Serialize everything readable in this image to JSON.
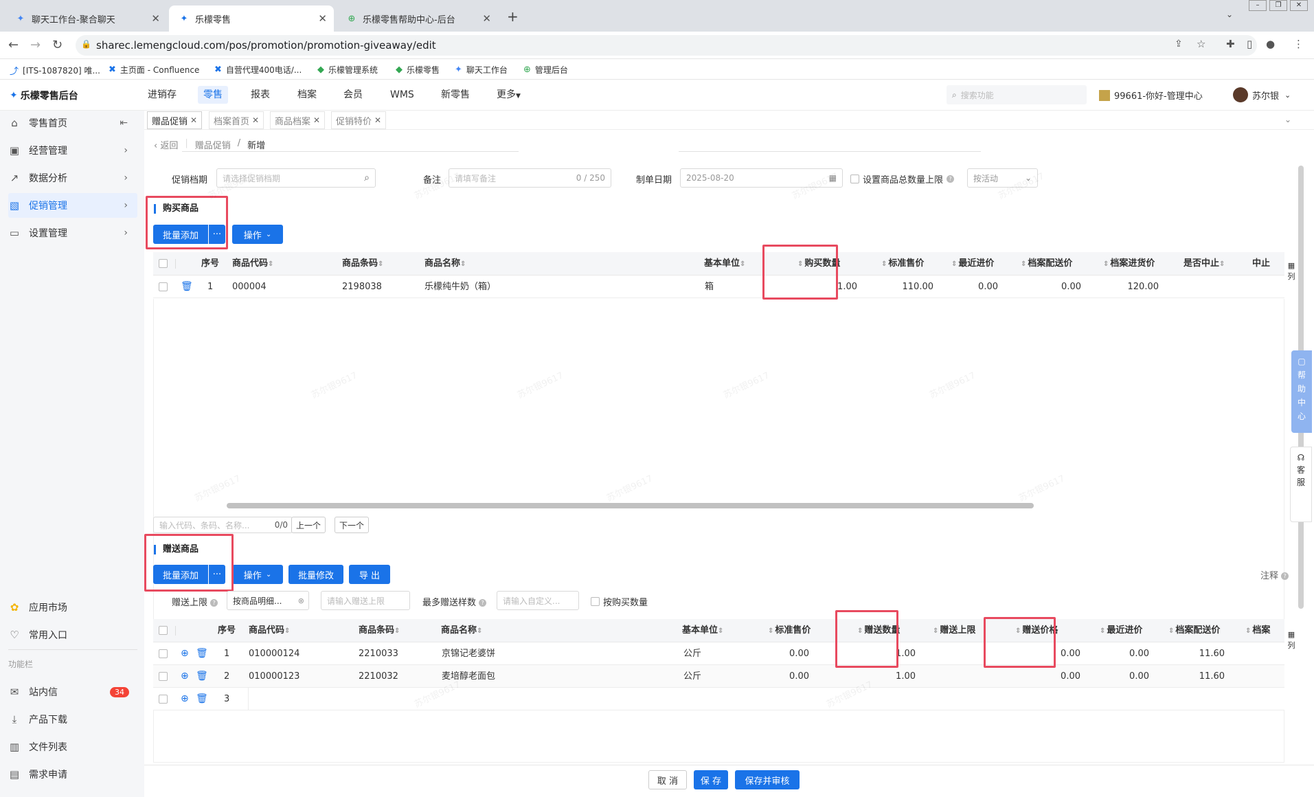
{
  "browser": {
    "tabs": [
      {
        "title": "聊天工作台-聚合聊天"
      },
      {
        "title": "乐檬零售"
      },
      {
        "title": "乐檬零售帮助中心-后台"
      }
    ],
    "url": "sharec.lemengcloud.com/pos/promotion/promotion-giveaway/edit",
    "bookmarks": [
      {
        "label": "[ITS-1087820] 唯..."
      },
      {
        "label": "主页面 - Confluence"
      },
      {
        "label": "自营代理400电话/..."
      },
      {
        "label": "乐檬管理系统"
      },
      {
        "label": "乐檬零售"
      },
      {
        "label": "聊天工作台"
      },
      {
        "label": "管理后台"
      }
    ]
  },
  "header": {
    "logo": "乐檬零售后台",
    "nav": [
      "进销存",
      "零售",
      "报表",
      "档案",
      "会员",
      "WMS",
      "新零售",
      "更多"
    ],
    "search_placeholder": "搜索功能",
    "store": "99661-你好-管理中心",
    "user": "苏尔银"
  },
  "sidebar": {
    "items": [
      {
        "label": "零售首页",
        "icon": "home-icon"
      },
      {
        "label": "经营管理",
        "icon": "dashboard-icon"
      },
      {
        "label": "数据分析",
        "icon": "chart-icon"
      },
      {
        "label": "促销管理",
        "icon": "promotion-icon"
      },
      {
        "label": "设置管理",
        "icon": "folder-icon"
      }
    ],
    "bottom": [
      {
        "label": "应用市场",
        "icon": "apps-icon"
      },
      {
        "label": "常用入口",
        "icon": "heart-icon"
      }
    ],
    "section_label": "功能栏",
    "func": [
      {
        "label": "站内信",
        "icon": "mail-icon",
        "badge": "34"
      },
      {
        "label": "产品下载",
        "icon": "download-icon"
      },
      {
        "label": "文件列表",
        "icon": "file-icon"
      },
      {
        "label": "需求申请",
        "icon": "request-icon"
      }
    ]
  },
  "page_tabs": [
    {
      "label": "赠品促销"
    },
    {
      "label": "档案首页"
    },
    {
      "label": "商品档案"
    },
    {
      "label": "促销特价"
    }
  ],
  "breadcrumb": {
    "back": "返回",
    "parent": "赠品促销",
    "current": "新增"
  },
  "form": {
    "promo_file_label": "促销档期",
    "promo_file_placeholder": "请选择促销档期",
    "remark_label": "备注",
    "remark_placeholder": "请填写备注",
    "remark_count": "0 / 250",
    "date_label": "制单日期",
    "date_value": "2025-08-20",
    "limit_label": "设置商品总数量上限",
    "limit_select": "按活动"
  },
  "buy_section": {
    "title": "购买商品",
    "batch_add": "批量添加",
    "more": "···",
    "operate": "操作",
    "columns": [
      "序号",
      "商品代码",
      "商品条码",
      "商品名称",
      "基本单位",
      "购买数量",
      "标准售价",
      "最近进价",
      "档案配送价",
      "档案进货价",
      "是否中止",
      "中止"
    ],
    "rows": [
      {
        "no": "1",
        "code": "000004",
        "barcode": "2198038",
        "name": "乐檬纯牛奶（箱）",
        "unit": "箱",
        "qty": "1.00",
        "price": "110.00",
        "last": "0.00",
        "dist": "0.00",
        "purchase": "120.00"
      }
    ],
    "col_setting": "列",
    "search_placeholder": "输入代码、条码、名称...",
    "search_count": "0/0",
    "prev": "上一个",
    "next": "下一个"
  },
  "gift_section": {
    "title": "赠送商品",
    "batch_add": "批量添加",
    "more": "···",
    "operate": "操作",
    "batch_edit": "批量修改",
    "export": "导 出",
    "note": "注释",
    "limit_label": "赠送上限",
    "limit_value": "按商品明细...",
    "limit_input_placeholder": "请输入赠送上限",
    "max_kinds_label": "最多赠送样数",
    "max_kinds_placeholder": "请输入自定义...",
    "by_buy_qty": "按购买数量",
    "columns": [
      "序号",
      "商品代码",
      "商品条码",
      "商品名称",
      "基本单位",
      "标准售价",
      "赠送数量",
      "赠送上限",
      "赠送价格",
      "最近进价",
      "档案配送价",
      "档案"
    ],
    "rows": [
      {
        "no": "1",
        "code": "010000124",
        "barcode": "2210033",
        "name": "京锦记老婆饼",
        "unit": "公斤",
        "price": "0.00",
        "qty": "1.00",
        "limit": "",
        "gprice": "0.00",
        "last": "0.00",
        "dist": "11.60"
      },
      {
        "no": "2",
        "code": "010000123",
        "barcode": "2210032",
        "name": "麦培醇老面包",
        "unit": "公斤",
        "price": "0.00",
        "qty": "1.00",
        "limit": "",
        "gprice": "0.00",
        "last": "0.00",
        "dist": "11.60"
      },
      {
        "no": "3",
        "code": "",
        "barcode": "",
        "name": "",
        "unit": "",
        "price": "",
        "qty": "",
        "limit": "",
        "gprice": "",
        "last": "",
        "dist": ""
      }
    ],
    "col_setting": "列"
  },
  "footer": {
    "cancel": "取 消",
    "save": "保 存",
    "save_audit": "保存并审核"
  },
  "side_help": {
    "help": "帮助中心",
    "service": "客服"
  },
  "watermark": "苏尔银9617",
  "colors": {
    "accent": "#1a73e8",
    "highlight": "#e84a5f",
    "badge": "#f44336"
  }
}
